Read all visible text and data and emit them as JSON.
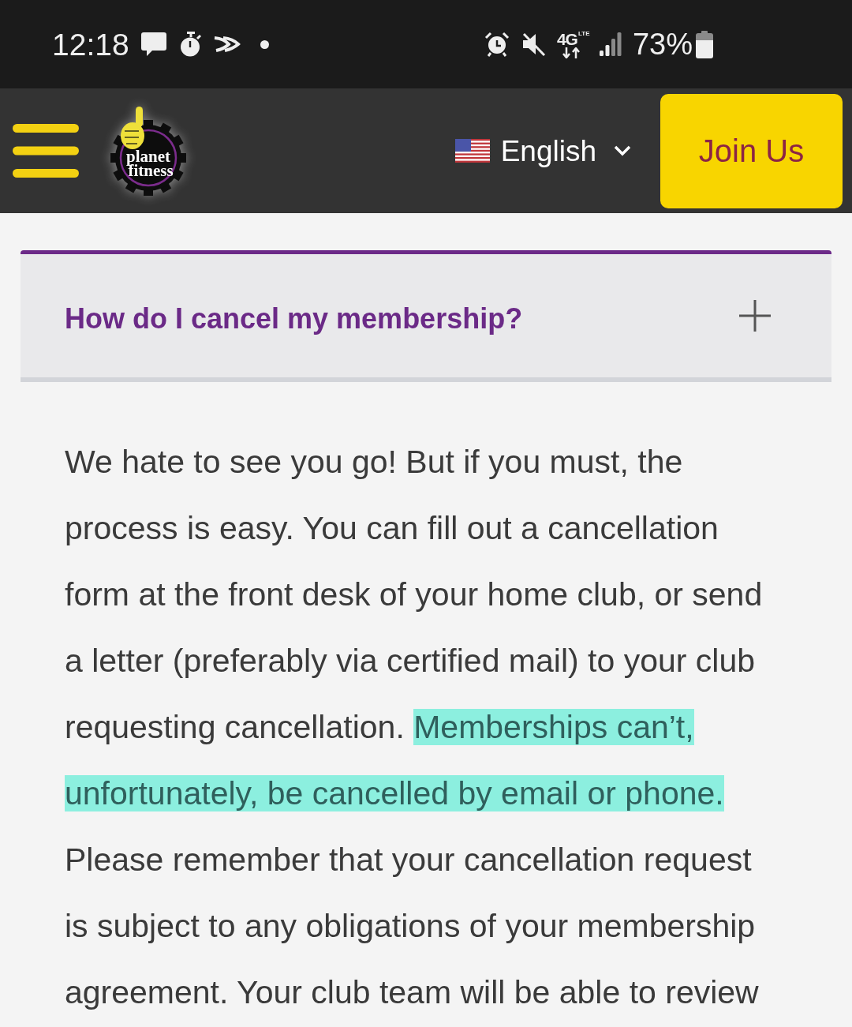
{
  "status_bar": {
    "time": "12:18",
    "network_label": "4G",
    "network_sublabel": "LTE",
    "battery": "73%"
  },
  "header": {
    "logo": {
      "line1": "planet",
      "line2": "fitness"
    },
    "language": {
      "label": "English"
    },
    "join_button": "Join Us"
  },
  "faq": {
    "question": "How do I cancel my membership?",
    "expanded": false,
    "answer": [
      {
        "text": "We hate to see you go! But if you must, the process is easy. You can fill out a cancellation form at the front desk of your home club, or send a letter (preferably via certified mail) to your club requesting cancellation. ",
        "highlighted": false
      },
      {
        "text": "Memberships can’t, unfortunately, be cancelled by email or phone.",
        "highlighted": true
      },
      {
        "text": " Please remember that your cancellation request is subject to any obligations of your membership agreement. Your club team will be able to review",
        "highlighted": false
      }
    ]
  }
}
